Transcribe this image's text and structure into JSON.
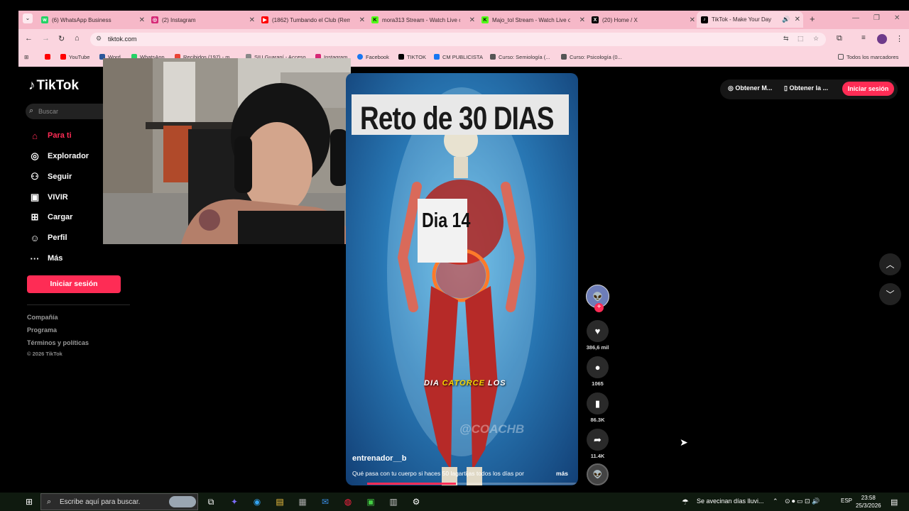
{
  "browser": {
    "tabs": [
      {
        "title": "(6) WhatsApp Business",
        "icon": "whatsapp-icon",
        "color": "#25d366",
        "active": false
      },
      {
        "title": "(2) Instagram",
        "icon": "instagram-icon",
        "color": "#d62976",
        "active": false
      },
      {
        "title": "(1862) Tumbando el Club (Remi",
        "icon": "youtube-icon",
        "color": "#ff0000",
        "active": false
      },
      {
        "title": "mora313 Stream - Watch Live o",
        "icon": "kick-icon",
        "color": "#53fc18",
        "active": false
      },
      {
        "title": "Majo_tol Stream - Watch Live o",
        "icon": "kick-icon",
        "color": "#53fc18",
        "active": false
      },
      {
        "title": "(20) Home / X",
        "icon": "x-icon",
        "color": "#000000",
        "active": false
      },
      {
        "title": "TikTok - Make Your Day",
        "icon": "tiktok-icon",
        "color": "#000000",
        "active": true
      }
    ],
    "url": "tiktok.com",
    "bookmarks": [
      "YouTube",
      "Word",
      "WhatsApp",
      "Recibidos (197) - m...",
      "SIU Guaraní - Acceso",
      "Instagram",
      "Facebook",
      "TIKTOK",
      "CM PUBLICISTA",
      "Curso: Semiología (...",
      "Curso: Psicología (0..."
    ],
    "all_bookmarks": "Todos los marcadores"
  },
  "tiktok": {
    "logo": "TikTok",
    "search_placeholder": "Buscar",
    "nav": [
      {
        "label": "Para ti",
        "icon": "home-icon",
        "active": true
      },
      {
        "label": "Explorador",
        "icon": "compass-icon",
        "active": false
      },
      {
        "label": "Seguir",
        "icon": "follow-icon",
        "active": false
      },
      {
        "label": "VIVIR",
        "icon": "live-icon",
        "active": false
      },
      {
        "label": "Cargar",
        "icon": "upload-icon",
        "active": false
      },
      {
        "label": "Perfil",
        "icon": "profile-icon",
        "active": false
      },
      {
        "label": "Más",
        "icon": "more-icon",
        "active": false
      }
    ],
    "login_button": "Iniciar sesión",
    "footer": [
      "Compañía",
      "Programa",
      "Términos y políticas"
    ],
    "copyright": "© 2026 TikTok",
    "top_buttons": [
      "Obtener M...",
      "Obtener la ...",
      "Iniciar sesión"
    ],
    "video": {
      "banner": "Reto de 30 DIAS",
      "sign": "Dia 14",
      "caption_pre": "DIA ",
      "caption_highlight": "CATORCE",
      "caption_post": " LOS",
      "watermark": "@COACHB",
      "username": "entrenador__b",
      "description": "Qué pasa con tu cuerpo si haces 50 lagartijas todos los días por",
      "more": "más",
      "progress": 0.42
    },
    "actions": [
      {
        "icon": "heart-icon",
        "count": "386,6 mil"
      },
      {
        "icon": "comment-icon",
        "count": "1065"
      },
      {
        "icon": "bookmark-icon",
        "count": "86.3K"
      },
      {
        "icon": "share-icon",
        "count": "11.4K"
      }
    ]
  },
  "taskbar": {
    "search_placeholder": "Escribe aquí para buscar.",
    "weather": "Se avecinan días lluvi...",
    "lang": "ESP",
    "time": "23:58",
    "date": "25/3/2026"
  }
}
